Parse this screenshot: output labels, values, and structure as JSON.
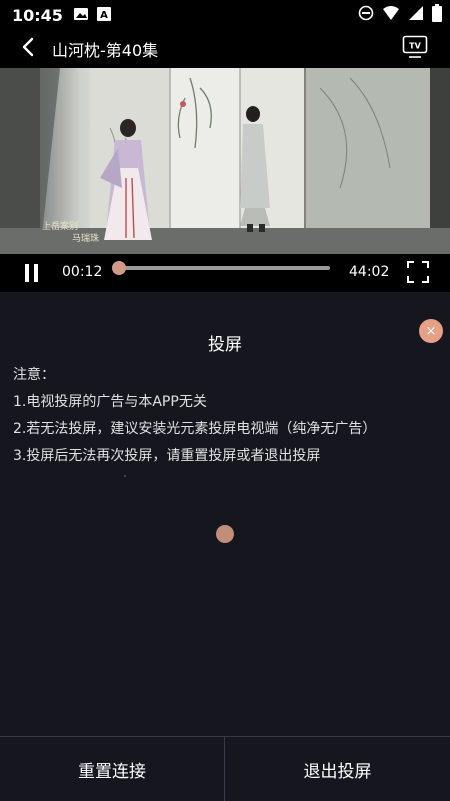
{
  "status_bar": {
    "time": "10:45",
    "left_icons": [
      "image-icon",
      "text-icon"
    ],
    "right_icons": [
      "dnd-icon",
      "wifi-icon",
      "signal-icon",
      "battery-icon"
    ]
  },
  "header": {
    "title": "山河枕-第40集",
    "back_icon": "back-arrow-icon",
    "tv_icon": "tv-icon",
    "tv_label": "TV"
  },
  "video": {
    "caption_role": "上岳案别",
    "caption_name": "马瑞珠"
  },
  "player": {
    "current_time": "00:12",
    "total_time": "44:02",
    "progress": 0.005
  },
  "cast_panel": {
    "title": "投屏",
    "close_symbol": "×",
    "notes": [
      "注意：",
      "1.电视投屏的广告与本APP无关",
      "2.若无法投屏，建议安装光元素投屏电视端（纯净无广告）",
      "3.投屏后无法再次投屏，请重置投屏或者退出投屏"
    ]
  },
  "actions": {
    "reset_label": "重置连接",
    "exit_label": "退出投屏"
  },
  "colors": {
    "accent": "#e7a088",
    "thumb": "#cf9b86",
    "panel_bg": "#16161f"
  }
}
